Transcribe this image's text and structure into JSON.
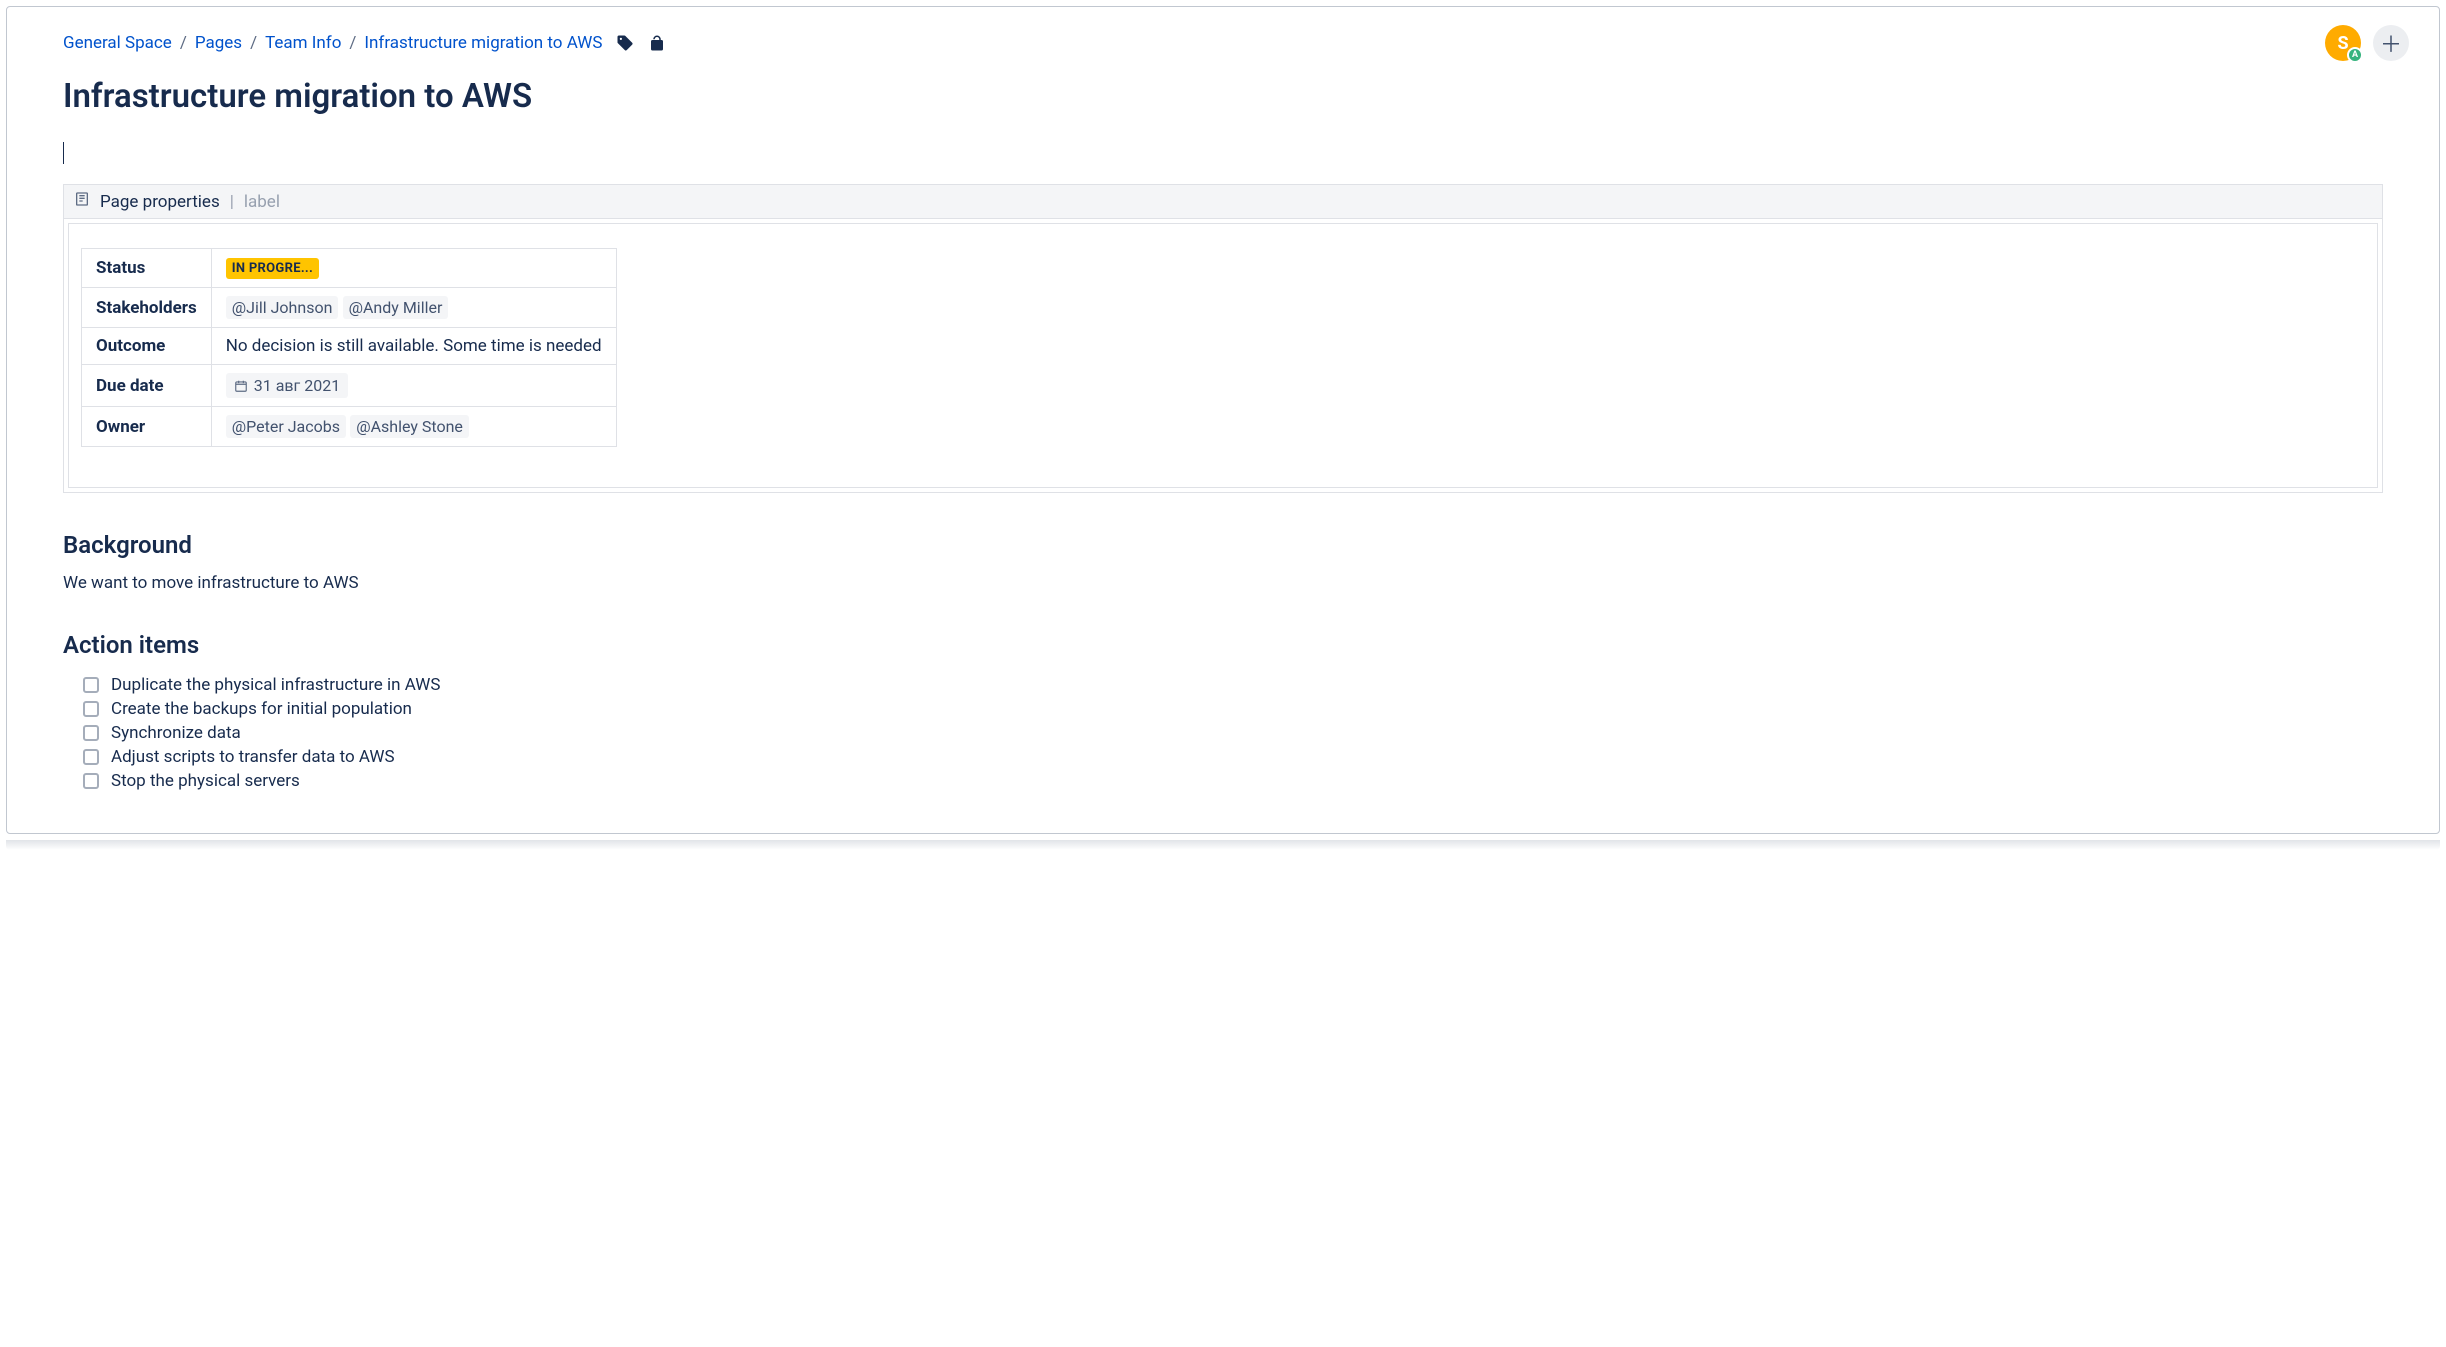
{
  "breadcrumbs": {
    "items": [
      {
        "label": "General Space"
      },
      {
        "label": "Pages"
      },
      {
        "label": "Team Info"
      },
      {
        "label": "Infrastructure migration to AWS"
      }
    ],
    "separator": "/"
  },
  "avatar": {
    "letter": "S",
    "badge": "A"
  },
  "title": "Infrastructure migration to AWS",
  "macro": {
    "name": "Page properties",
    "separator": "|",
    "label_placeholder": "label"
  },
  "properties": {
    "rows": [
      {
        "key": "Status"
      },
      {
        "key": "Stakeholders"
      },
      {
        "key": "Outcome"
      },
      {
        "key": "Due date"
      },
      {
        "key": "Owner"
      }
    ],
    "status_value": "IN PROGRE...",
    "stakeholders": [
      "@Jill Johnson",
      "@Andy Miller"
    ],
    "outcome": "No decision is still available. Some time is needed",
    "due_date": "31 авг 2021",
    "owner": [
      "@Peter Jacobs",
      "@Ashley Stone"
    ]
  },
  "sections": {
    "background_heading": "Background",
    "background_text": "We want to move infrastructure to AWS",
    "action_heading": "Action items",
    "action_items": [
      "Duplicate the physical infrastructure in AWS",
      "Create the backups for initial population",
      "Synchronize data",
      "Adjust scripts to transfer data to AWS",
      "Stop the physical servers"
    ]
  }
}
